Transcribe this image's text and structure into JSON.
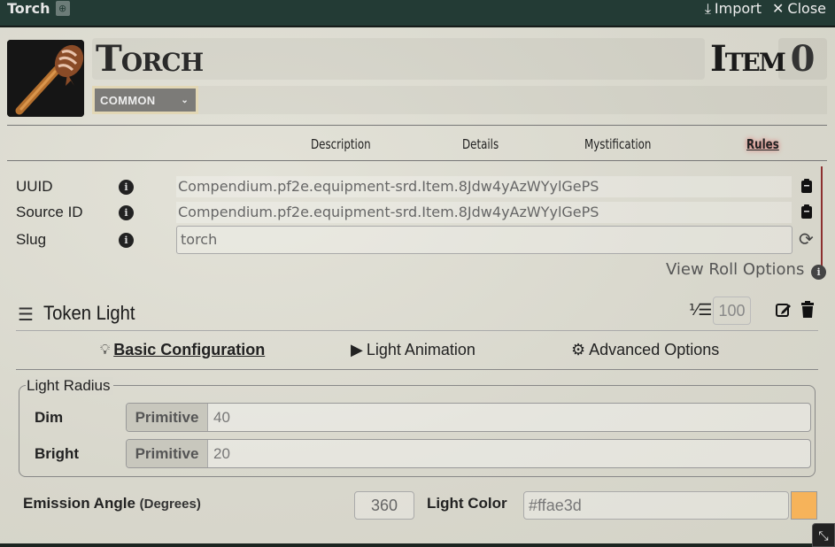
{
  "window": {
    "title": "Torch",
    "import_label": "Import",
    "close_label": "Close"
  },
  "header": {
    "item_name": "Torch",
    "item_type": "Item",
    "level": "0",
    "rarity": "COMMON"
  },
  "nav": {
    "tabs": [
      {
        "label": "Description",
        "active": false
      },
      {
        "label": "Details",
        "active": false
      },
      {
        "label": "Mystification",
        "active": false
      },
      {
        "label": "Rules",
        "active": true
      }
    ]
  },
  "rules": {
    "uuid_label": "UUID",
    "uuid_value": "Compendium.pf2e.equipment-srd.Item.8Jdw4yAzWYylGePS",
    "source_id_label": "Source ID",
    "source_id_value": "Compendium.pf2e.equipment-srd.Item.8Jdw4yAzWYylGePS",
    "slug_label": "Slug",
    "slug_value": "torch",
    "view_roll_options": "View Roll Options"
  },
  "rule_element": {
    "title": "Token Light",
    "priority": "100",
    "subtabs": [
      {
        "label": "Basic Configuration",
        "icon": "lightbulb-icon",
        "active": true
      },
      {
        "label": "Light Animation",
        "icon": "play-icon",
        "active": false
      },
      {
        "label": "Advanced Options",
        "icon": "cogs-icon",
        "active": false
      }
    ],
    "light_radius": {
      "legend": "Light Radius",
      "dim_label": "Dim",
      "dim_mode": "Primitive",
      "dim_value": "40",
      "bright_label": "Bright",
      "bright_mode": "Primitive",
      "bright_value": "20"
    },
    "emission_angle_label": "Emission Angle",
    "emission_angle_unit": "(Degrees)",
    "emission_angle_value": "360",
    "light_color_label": "Light Color",
    "light_color_value": "#ffae3d",
    "light_color_swatch": "#f6b35a"
  }
}
